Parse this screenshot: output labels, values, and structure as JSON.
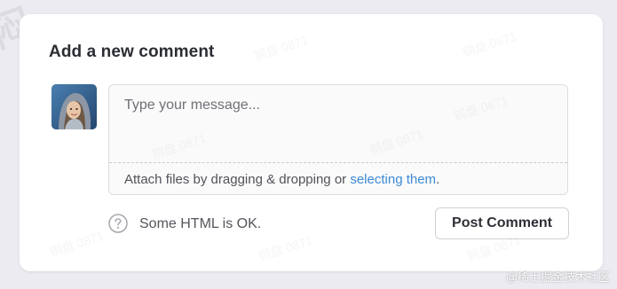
{
  "form": {
    "title": "Add a new comment",
    "message_placeholder": "Type your message...",
    "attach_prefix": "Attach files by dragging & dropping or ",
    "attach_link": "selecting them",
    "attach_suffix": ".",
    "help_text": "Some HTML is OK.",
    "post_button": "Post Comment"
  },
  "icons": {
    "help": "question-circle-icon",
    "avatar": "user-avatar"
  },
  "overlay": {
    "watermark_text": "铜盘 0871",
    "site_mark": "@稀土掘金技术社区",
    "corner_mark": "闷"
  },
  "colors": {
    "page_bg": "#ecebf1",
    "link": "#3b8ad6",
    "title": "#2b2d33"
  }
}
